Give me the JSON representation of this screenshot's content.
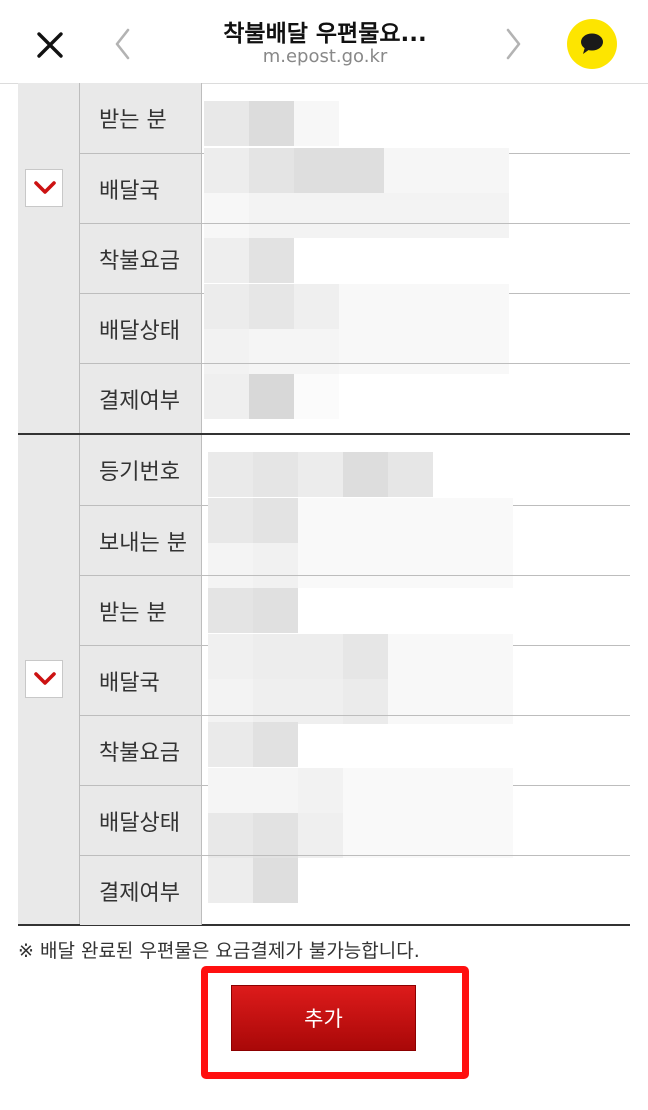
{
  "header": {
    "title": "착불배달 우편물요...",
    "url": "m.epost.go.kr"
  },
  "groups": [
    {
      "checked": true,
      "rows": [
        {
          "label": "받는 분"
        },
        {
          "label": "배달국"
        },
        {
          "label": "착불요금"
        },
        {
          "label": "배달상태"
        },
        {
          "label": "결제여부"
        }
      ]
    },
    {
      "checked": true,
      "rows": [
        {
          "label": "등기번호"
        },
        {
          "label": "보내는 분"
        },
        {
          "label": "받는 분"
        },
        {
          "label": "배달국"
        },
        {
          "label": "착불요금"
        },
        {
          "label": "배달상태"
        },
        {
          "label": "결제여부"
        }
      ]
    }
  ],
  "notice": "※ 배달 완료된 우편물은 요금결제가 불가능합니다.",
  "add_button": "추가",
  "colors": {
    "accent_red": "#cc1212",
    "highlight_red": "#ff1010",
    "kakao_yellow": "#fde500"
  },
  "icons": {
    "close": "close-icon",
    "back": "chevron-left-icon",
    "forward": "chevron-right-icon",
    "kakao": "kakaotalk-icon",
    "checkbox": "chevron-down-icon"
  }
}
